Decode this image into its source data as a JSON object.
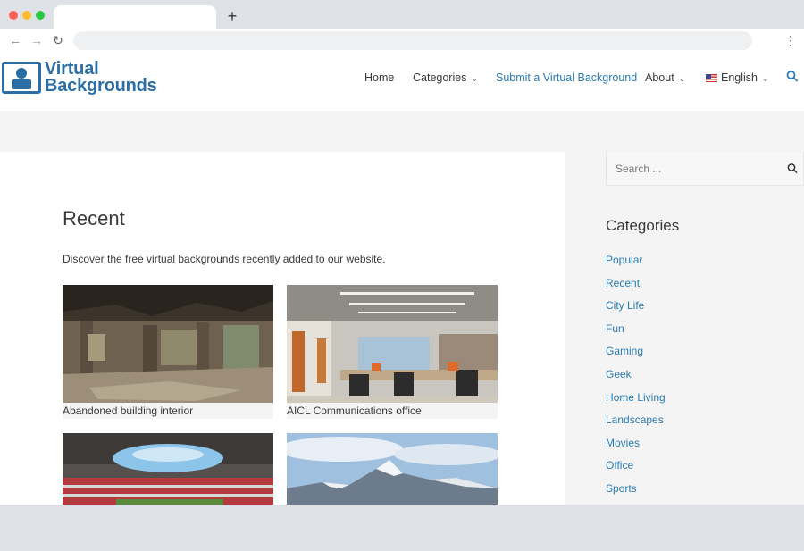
{
  "browser": {
    "new_tab_glyph": "+",
    "back_glyph": "←",
    "forward_glyph": "→",
    "reload_glyph": "↻",
    "menu_glyph": "⋮"
  },
  "site": {
    "logo_line1": "Virtual",
    "logo_line2": "Backgrounds",
    "brand_color": "#2b6ea6",
    "link_color": "#2b7bb5"
  },
  "nav": {
    "home": "Home",
    "categories": "Categories",
    "submit": "Submit a Virtual Background",
    "about": "About",
    "language": "English",
    "chevron": "⌄",
    "search_icon": "search-icon"
  },
  "main": {
    "title": "Recent",
    "description": "Discover the free virtual backgrounds recently added to our website.",
    "cards": [
      {
        "caption": "Abandoned building interior"
      },
      {
        "caption": "AICL Communications office"
      },
      {
        "caption": ""
      },
      {
        "caption": ""
      }
    ]
  },
  "sidebar": {
    "search_placeholder": "Search ...",
    "categories_title": "Categories",
    "categories": [
      "Popular",
      "Recent",
      "City Life",
      "Fun",
      "Gaming",
      "Geek",
      "Home Living",
      "Landscapes",
      "Movies",
      "Office",
      "Sports"
    ]
  }
}
